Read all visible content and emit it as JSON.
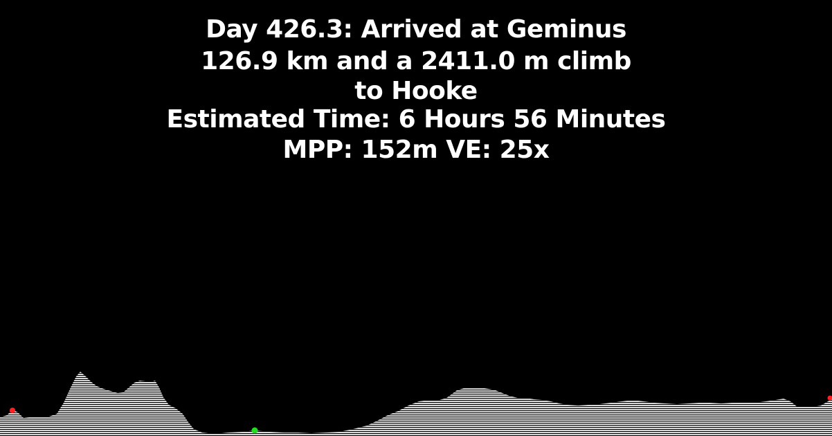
{
  "header": {
    "line1": "Day 426.3: Arrived at Geminus",
    "line2": "126.9 km and a 2411.0 m climb",
    "line3": "to Hooke",
    "line4": "Estimated Time: 6 Hours 56 Minutes",
    "line5": "MPP: 152m VE: 25x"
  },
  "profile": {
    "fill_color": "#d8d8d8",
    "marker_colors": {
      "start": "#ff2020",
      "current": "#22dd22",
      "end": "#ff2020"
    }
  }
}
